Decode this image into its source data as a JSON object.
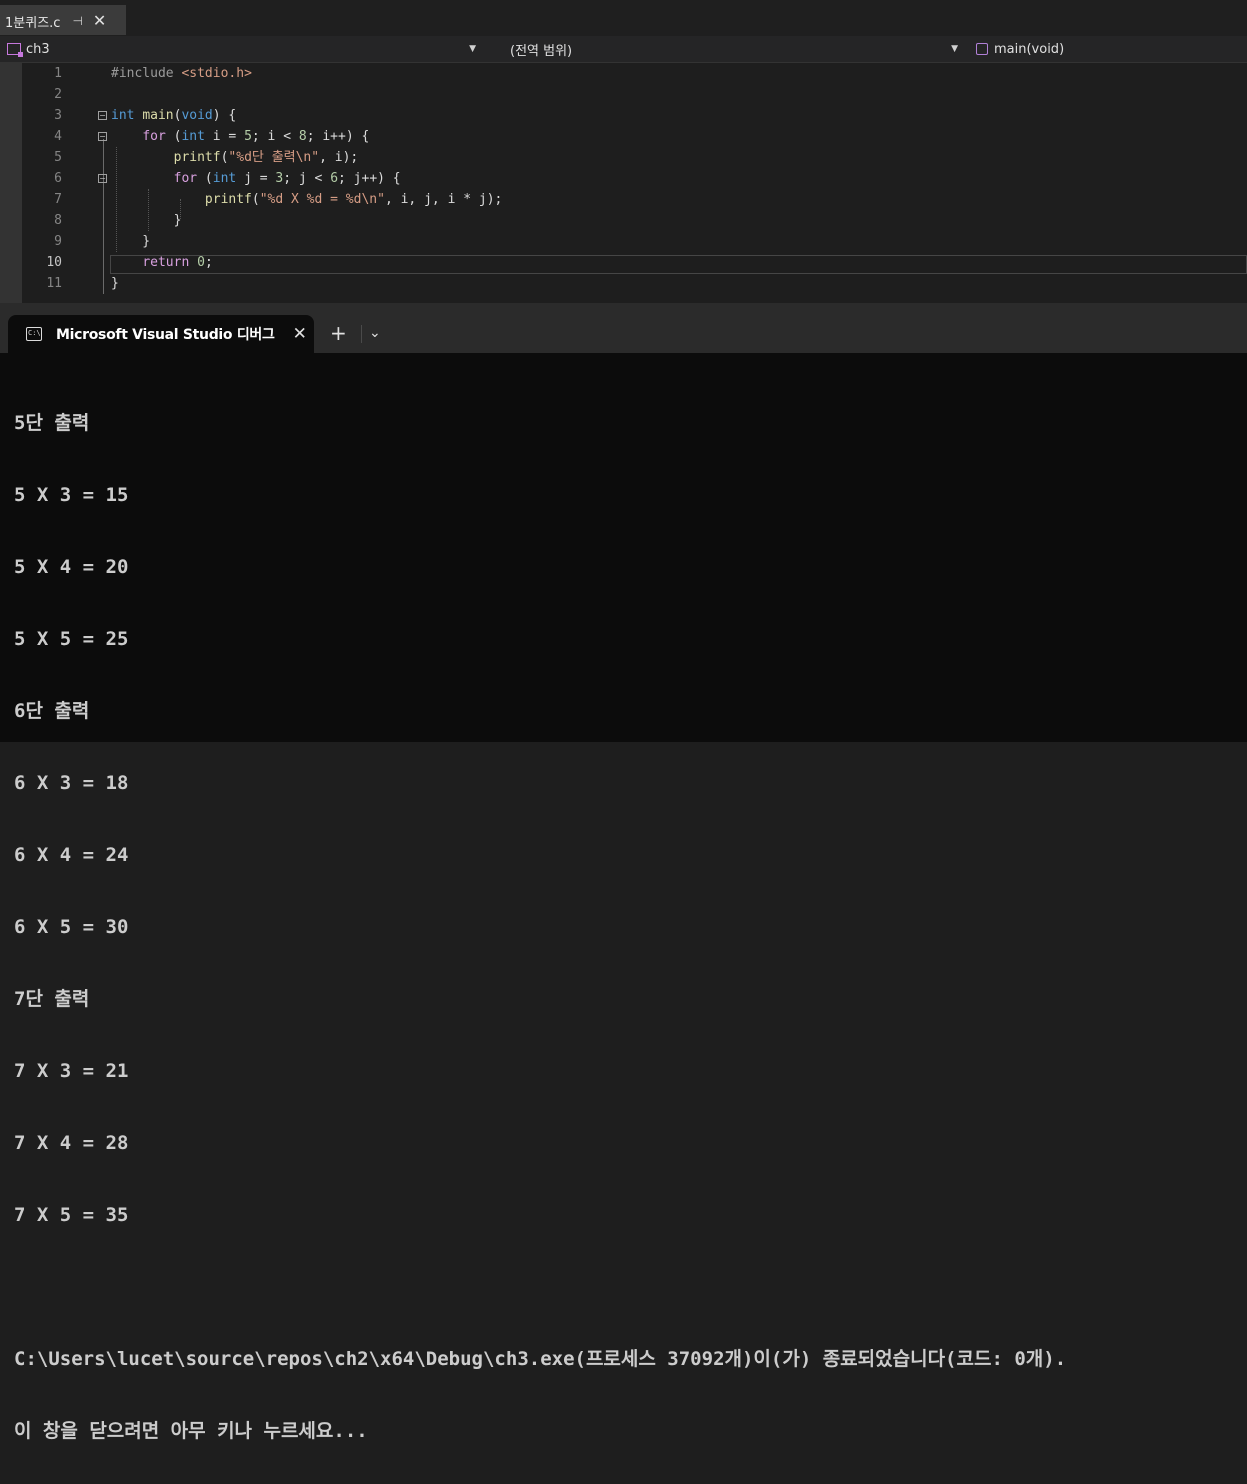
{
  "tabstrip": {
    "file_tab": {
      "name": "1분퀴즈.c",
      "pin": "⊣",
      "close": "✕"
    }
  },
  "navbar": {
    "project": "ch3",
    "scope": "(전역 범위)",
    "member": "main(void)"
  },
  "editor": {
    "current_line": 10,
    "line_numbers": [
      "1",
      "2",
      "3",
      "4",
      "5",
      "6",
      "7",
      "8",
      "9",
      "10",
      "11"
    ]
  },
  "terminal": {
    "tab_title": "Microsoft Visual Studio 디버그",
    "tab_close": "✕",
    "new_tab": "+",
    "dropdown": "⌄",
    "output": [
      "5단 출력",
      "5 X 3 = 15",
      "5 X 4 = 20",
      "5 X 5 = 25",
      "6단 출력",
      "6 X 3 = 18",
      "6 X 4 = 24",
      "6 X 5 = 30",
      "7단 출력",
      "7 X 3 = 21",
      "7 X 4 = 28",
      "7 X 5 = 35",
      "",
      "C:\\Users\\lucet\\source\\repos\\ch2\\x64\\Debug\\ch3.exe(프로세스 37092개)이(가) 종료되었습니다(코드: 0개).",
      "이 창을 닫으려면 아무 키나 누르세요..."
    ]
  },
  "colors": {
    "keyword": "#569cd6",
    "control_keyword": "#d8a0df",
    "string": "#d69d85",
    "number": "#b5cea8",
    "terminal_bg": "#0c0c0c",
    "editor_bg": "#1e1e1e"
  },
  "icons": {
    "project": "project-icon",
    "member": "cube-icon",
    "terminal": "cmd-icon"
  }
}
